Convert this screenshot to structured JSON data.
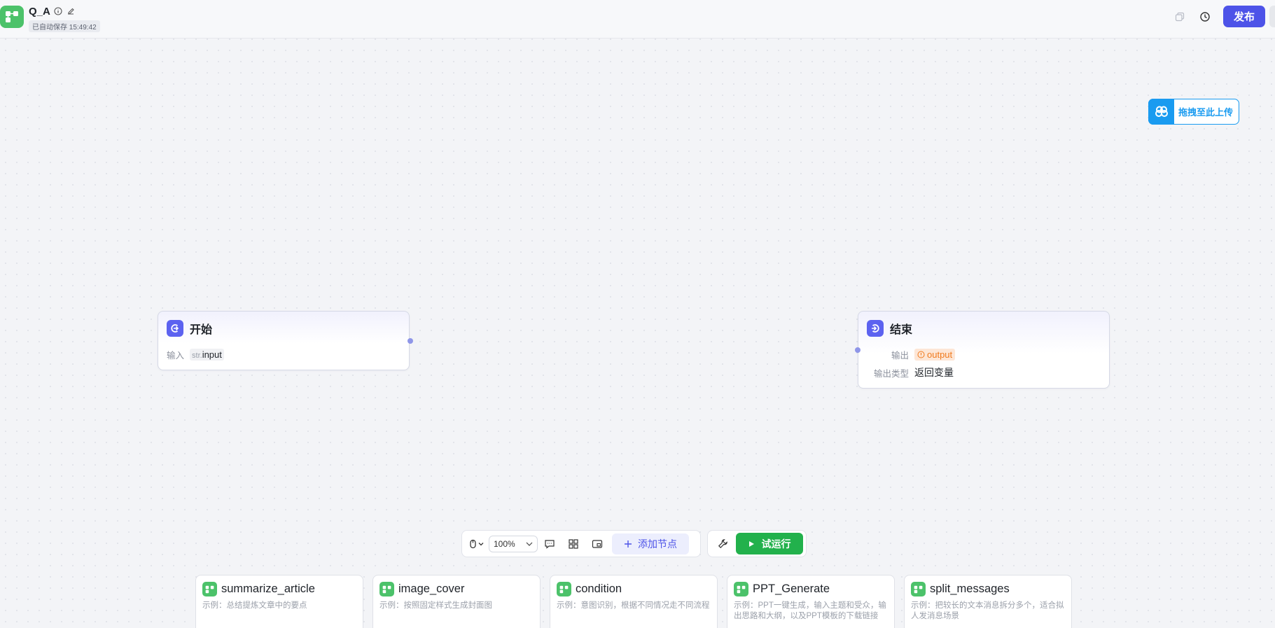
{
  "header": {
    "title": "Q_A",
    "autosave": "已自动保存 15:49:42",
    "publish_label": "发布"
  },
  "upload": {
    "label": "拖拽至此上传"
  },
  "start_node": {
    "title": "开始",
    "input_label": "输入",
    "input_type": "str.",
    "input_name": "input"
  },
  "end_node": {
    "title": "结束",
    "output_label": "输出",
    "output_var": "output",
    "output_type_label": "输出类型",
    "output_type_value": "返回变量"
  },
  "toolbar": {
    "zoom": "100%",
    "add_node_label": "添加节点",
    "run_label": "试运行"
  },
  "templates": [
    {
      "name": "summarize_article",
      "desc": "示例：总结提炼文章中的要点"
    },
    {
      "name": "image_cover",
      "desc": "示例：按照固定样式生成封面图"
    },
    {
      "name": "condition",
      "desc": "示例：意图识别，根据不同情况走不同流程"
    },
    {
      "name": "PPT_Generate",
      "desc": "示例：PPT一键生成，输入主题和受众，输出思路和大纲，以及PPT模板的下载链接"
    },
    {
      "name": "split_messages",
      "desc": "示例：把较长的文本消息拆分多个，适合拟人发消息场景"
    }
  ],
  "colors": {
    "accent": "#4d53e8",
    "run": "#22b14c",
    "upload": "#1a9bf0",
    "output_chip": "#f07a1d",
    "node_icon": "#5c62f0",
    "template_icon": "#4cc26a"
  }
}
